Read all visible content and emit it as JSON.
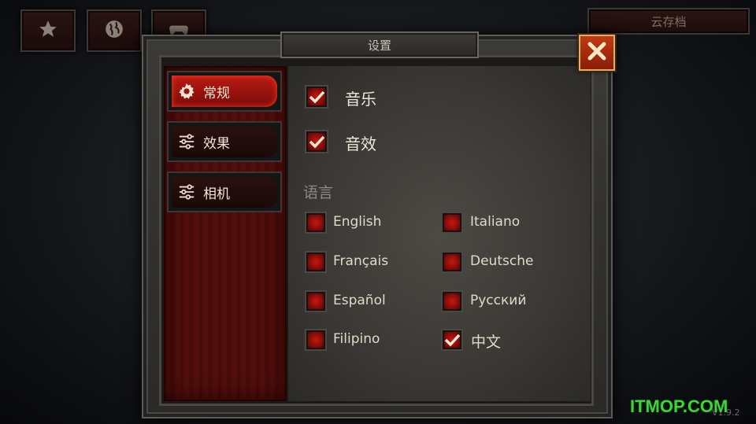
{
  "top_bar": {
    "buttons": [
      {
        "icon": "star-icon"
      },
      {
        "icon": "globe-icon"
      },
      {
        "icon": "gamepad-icon"
      }
    ],
    "cloud_save_label": "云存档"
  },
  "dialog": {
    "title": "设置",
    "close_icon": "close-icon",
    "tabs": [
      {
        "label": "常规",
        "icon": "gear-icon",
        "active": true
      },
      {
        "label": "效果",
        "icon": "sliders-icon",
        "active": false
      },
      {
        "label": "相机",
        "icon": "sliders-icon",
        "active": false
      }
    ],
    "options": [
      {
        "label": "音乐",
        "checked": true
      },
      {
        "label": "音效",
        "checked": true
      }
    ],
    "language_heading": "语言",
    "languages": [
      {
        "label": "English",
        "checked": false
      },
      {
        "label": "Italiano",
        "checked": false
      },
      {
        "label": "Français",
        "checked": false
      },
      {
        "label": "Deutsche",
        "checked": false
      },
      {
        "label": "Español",
        "checked": false
      },
      {
        "label": "Русский",
        "checked": false
      },
      {
        "label": "Filipino",
        "checked": false
      },
      {
        "label": "中文",
        "checked": true
      }
    ]
  },
  "version": "V1.9.2",
  "watermark": "ITMOP.COM",
  "colors": {
    "accent_red": "#b81b12",
    "checkmark": "#f3ead8",
    "close_orange": "#c23a12",
    "watermark_green": "#3cd438"
  }
}
